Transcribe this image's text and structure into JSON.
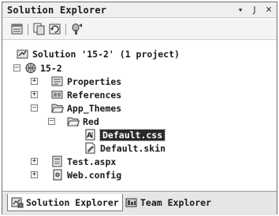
{
  "window": {
    "title": "Solution Explorer",
    "pin_glyph": "↓ †",
    "close_glyph": "×"
  },
  "toolbar": {
    "icons": [
      "properties-icon",
      "show-all-files-icon",
      "refresh-icon",
      "view-designer-icon"
    ]
  },
  "tree": {
    "solution_label": "Solution '15-2' (1 project)",
    "project_label": "15-2",
    "items": {
      "properties": "Properties",
      "references": "References",
      "app_themes": "App_Themes",
      "red": "Red",
      "default_css": "Default.css",
      "default_skin": "Default.skin",
      "test_aspx": "Test.aspx",
      "web_config": "Web.config"
    }
  },
  "tabs": {
    "solution_explorer": "Solution Explorer",
    "team_explorer": "Team Explorer"
  }
}
